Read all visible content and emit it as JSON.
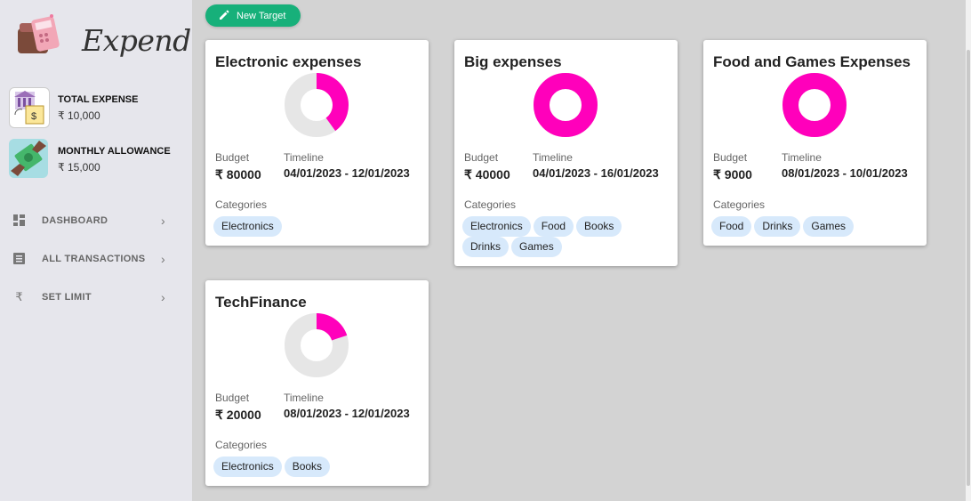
{
  "app": {
    "name": "Expendio"
  },
  "sidebar": {
    "stats": [
      {
        "title": "TOTAL EXPENSE",
        "value": "₹ 10,000",
        "icon": "bank-receipt-icon"
      },
      {
        "title": "MONTHLY ALLOWANCE",
        "value": "₹ 15,000",
        "icon": "money-hand-icon"
      }
    ],
    "nav": [
      {
        "label": "DASHBOARD",
        "icon": "dashboard-icon"
      },
      {
        "label": "ALL TRANSACTIONS",
        "icon": "list-icon"
      },
      {
        "label": "SET LIMIT",
        "icon": "rupee-icon"
      }
    ]
  },
  "toolbar": {
    "new_target_label": "New Target"
  },
  "labels": {
    "budget": "Budget",
    "timeline": "Timeline",
    "categories": "Categories"
  },
  "colors": {
    "accent": "#17b07a",
    "donut_fill": "#ff00bb",
    "donut_track": "#e6e6e6",
    "chip_bg": "#d7e9fb"
  },
  "targets": [
    {
      "title": "Electronic expenses",
      "budget": "₹ 80000",
      "timeline": "04/01/2023 - 12/01/2023",
      "categories": [
        "Electronics"
      ],
      "spent_fraction": 0.4
    },
    {
      "title": "Big expenses",
      "budget": "₹ 40000",
      "timeline": "04/01/2023 - 16/01/2023",
      "categories": [
        "Electronics",
        "Food",
        "Books",
        "Drinks",
        "Games"
      ],
      "spent_fraction": 1.0
    },
    {
      "title": "Food and Games Expenses",
      "budget": "₹ 9000",
      "timeline": "08/01/2023 - 10/01/2023",
      "categories": [
        "Food",
        "Drinks",
        "Games"
      ],
      "spent_fraction": 1.0
    },
    {
      "title": "TechFinance",
      "budget": "₹ 20000",
      "timeline": "08/01/2023 - 12/01/2023",
      "categories": [
        "Electronics",
        "Books"
      ],
      "spent_fraction": 0.2
    }
  ]
}
